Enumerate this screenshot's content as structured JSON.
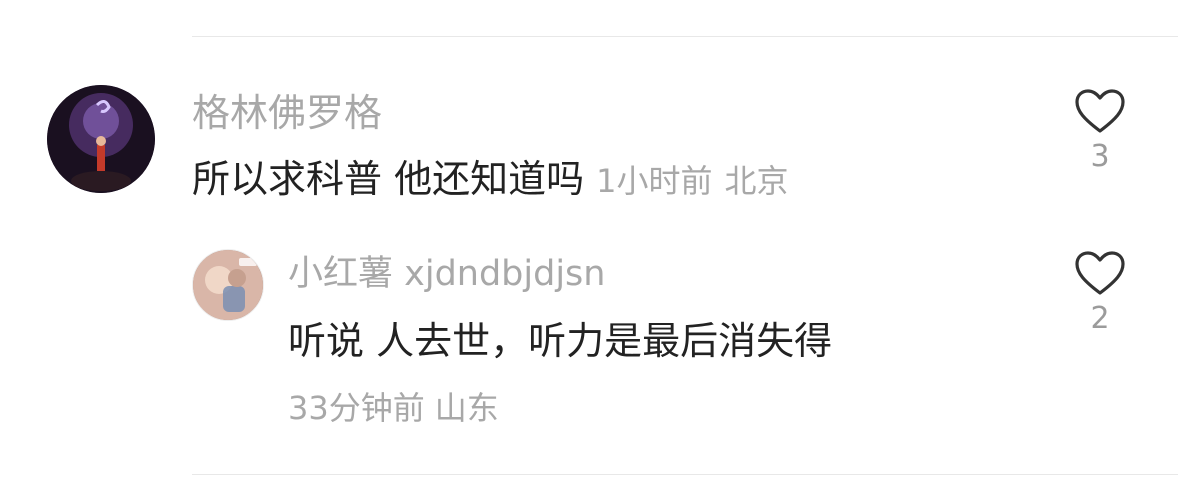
{
  "comment": {
    "username": "格林佛罗格",
    "text": "所以求科普 他还知道吗",
    "time": "1小时前",
    "location": "北京",
    "likes": "3"
  },
  "reply": {
    "username": "小红薯 xjdndbjdjsn",
    "text": "听说 人去世，听力是最后消失得",
    "time": "33分钟前",
    "location": "山东",
    "likes": "2"
  }
}
